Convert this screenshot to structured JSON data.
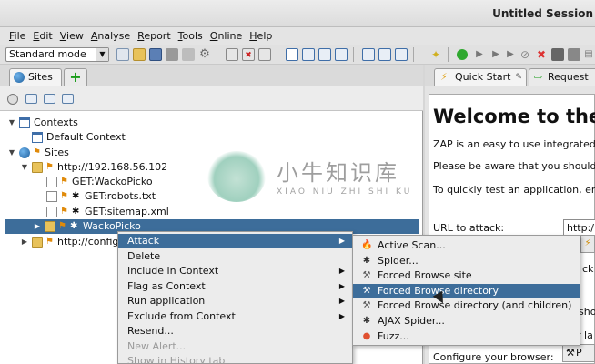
{
  "window": {
    "title": "Untitled Session"
  },
  "menubar": {
    "items": [
      {
        "key": "F",
        "rest": "ile"
      },
      {
        "key": "E",
        "rest": "dit"
      },
      {
        "key": "V",
        "rest": "iew"
      },
      {
        "key": "A",
        "rest": "nalyse"
      },
      {
        "key": "R",
        "rest": "eport"
      },
      {
        "key": "T",
        "rest": "ools"
      },
      {
        "key": "O",
        "rest": "nline"
      },
      {
        "key": "H",
        "rest": "elp"
      }
    ]
  },
  "toolbar": {
    "mode": "Standard mode",
    "mode_arrow": "▼"
  },
  "sites_panel": {
    "tab_label": "Sites",
    "add_tab": "+",
    "tree": [
      {
        "label": "Contexts",
        "toggle": "▼",
        "icon": "contexts-icon"
      },
      {
        "label": "Default Context",
        "toggle": "",
        "icon": "context-icon"
      },
      {
        "label": "Sites",
        "toggle": "▼",
        "icon": "globe-icon"
      },
      {
        "label": "http://192.168.56.102",
        "toggle": "▼",
        "icon": "folder-icon"
      },
      {
        "label": "GET:WackoPicko",
        "toggle": "",
        "icon": "page-icon"
      },
      {
        "label": "GET:robots.txt",
        "toggle": "",
        "icon": "page-icon"
      },
      {
        "label": "GET:sitemap.xml",
        "toggle": "",
        "icon": "page-icon"
      },
      {
        "label": "WackoPicko",
        "toggle": "▶",
        "icon": "folder-icon",
        "selected": true
      },
      {
        "label": "http://config.p",
        "toggle": "▶",
        "icon": "folder-icon"
      }
    ]
  },
  "watermark": {
    "cn": "小牛知识库",
    "en": "XIAO NIU ZHI SHI KU"
  },
  "right_panel": {
    "tabs": [
      {
        "label": "Quick Start",
        "icon": "⚡"
      },
      {
        "label": "Request",
        "icon": "⇨"
      }
    ],
    "welcome": "Welcome to the",
    "lines": [
      "ZAP is an easy to use integrated",
      "Please be aware that you should",
      "To quickly test an application, er"
    ],
    "url_label": "URL to attack:",
    "url_value": "http:/",
    "partial_ck": "ck",
    "partial_sho": "sho",
    "partial_la": "r la",
    "configure_label": "Configure your browser:",
    "browser_btn": "P"
  },
  "context_menu": {
    "items": [
      {
        "label": "Attack",
        "submenu": true,
        "highlighted": true
      },
      {
        "label": "Delete",
        "submenu": false
      },
      {
        "label": "Include in Context",
        "submenu": true
      },
      {
        "label": "Flag as Context",
        "submenu": true
      },
      {
        "label": "Run application",
        "submenu": true
      },
      {
        "label": "Exclude from Context",
        "submenu": true
      },
      {
        "label": "Resend...",
        "submenu": false
      },
      {
        "label": "New Alert...",
        "submenu": false,
        "disabled": true
      },
      {
        "label": "Show in History tab",
        "submenu": false,
        "disabled": true
      }
    ],
    "submenu_arrow": "▶"
  },
  "attack_submenu": {
    "items": [
      {
        "label": "Active Scan...",
        "icon": "fire-icon",
        "glyph": "🔥"
      },
      {
        "label": "Spider...",
        "icon": "spider-icon",
        "glyph": "✱"
      },
      {
        "label": "Forced Browse site",
        "icon": "hammer-icon",
        "glyph": "⚒"
      },
      {
        "label": "Forced Browse directory",
        "icon": "hammer-icon",
        "glyph": "⚒",
        "highlighted": true
      },
      {
        "label": "Forced Browse directory (and children)",
        "icon": "hammer-icon",
        "glyph": "⚒"
      },
      {
        "label": "AJAX Spider...",
        "icon": "spider-icon",
        "glyph": "✱"
      },
      {
        "label": "Fuzz...",
        "icon": "fuzz-icon",
        "glyph": "●"
      }
    ]
  },
  "colors": {
    "selection": "#3d6d9a",
    "menu_bg": "#ececec",
    "accent_green": "#1a9d1a"
  }
}
